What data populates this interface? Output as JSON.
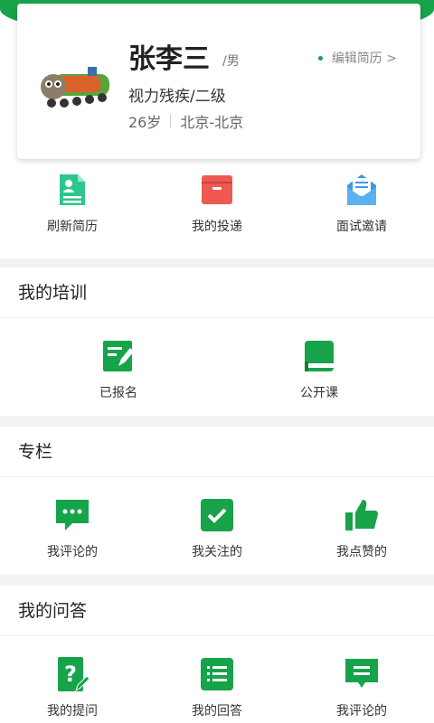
{
  "profile": {
    "name": "张李三",
    "gender": "/男",
    "edit_label": "编辑简历 >",
    "disability": "视力残疾/二级",
    "age": "26岁",
    "location": "北京-北京"
  },
  "quick_actions": [
    {
      "label": "刷新简历",
      "icon": "resume-icon"
    },
    {
      "label": "我的投递",
      "icon": "inbox-icon"
    },
    {
      "label": "面试邀请",
      "icon": "envelope-icon"
    }
  ],
  "training": {
    "title": "我的培训",
    "items": [
      {
        "label": "已报名",
        "icon": "signup-edit-icon"
      },
      {
        "label": "公开课",
        "icon": "book-icon"
      }
    ]
  },
  "column": {
    "title": "专栏",
    "items": [
      {
        "label": "我评论的",
        "icon": "comment-icon"
      },
      {
        "label": "我关注的",
        "icon": "check-icon"
      },
      {
        "label": "我点赞的",
        "icon": "thumbs-up-icon"
      }
    ]
  },
  "qa": {
    "title": "我的问答",
    "items": [
      {
        "label": "我的提问",
        "icon": "question-icon"
      },
      {
        "label": "我的回答",
        "icon": "answer-list-icon"
      },
      {
        "label": "我评论的",
        "icon": "comment-lines-icon"
      }
    ]
  },
  "colors": {
    "brand_green": "#17a34a",
    "doc_green": "#2dc68b",
    "inbox_red": "#ee5a52",
    "mail_blue": "#3a9ae8"
  }
}
